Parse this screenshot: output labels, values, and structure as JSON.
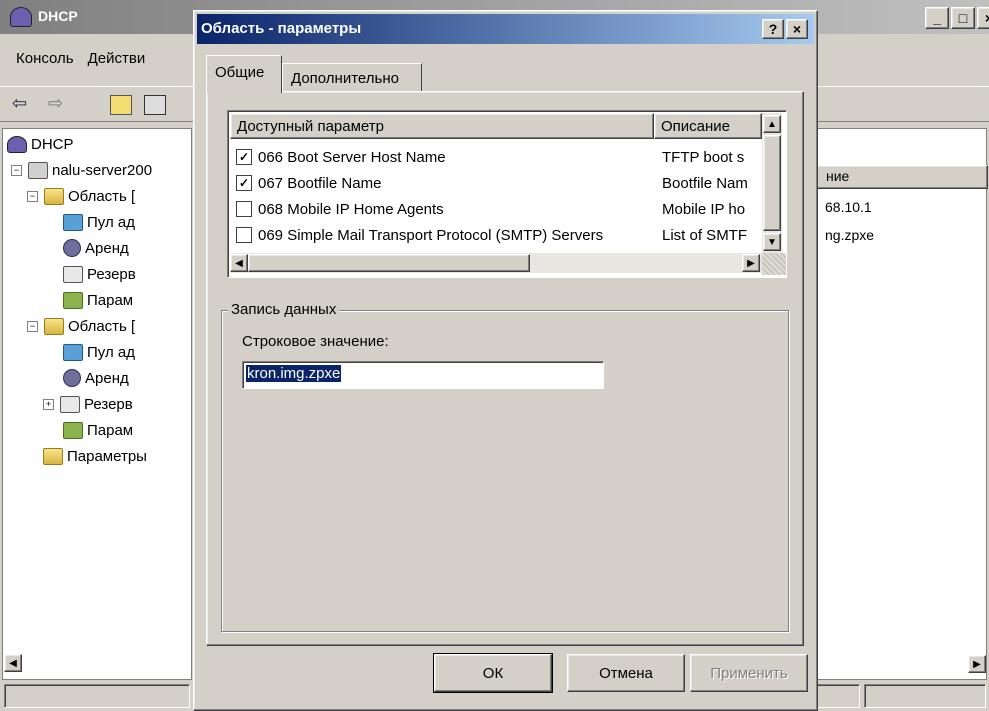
{
  "main_window": {
    "title": "DHCP",
    "menu": [
      "Консоль",
      "Действи"
    ],
    "tree": [
      {
        "label": "DHCP"
      },
      {
        "label": "nalu-server200"
      },
      {
        "label": "Область ["
      },
      {
        "label": "Пул ад"
      },
      {
        "label": "Аренд"
      },
      {
        "label": "Резерв"
      },
      {
        "label": "Парам"
      },
      {
        "label": "Область ["
      },
      {
        "label": "Пул ад"
      },
      {
        "label": "Аренд"
      },
      {
        "label": "Резерв"
      },
      {
        "label": "Парам"
      },
      {
        "label": "Параметры"
      }
    ],
    "right_header": "ние",
    "right_values": [
      "68.10.1",
      "ng.zpxe"
    ]
  },
  "dialog": {
    "title": "Область - параметры",
    "help_label": "?",
    "close_label": "×",
    "tabs": [
      "Общие",
      "Дополнительно"
    ],
    "list_headers": [
      "Доступный параметр",
      "Описание"
    ],
    "options": [
      {
        "name": "066 Boot Server Host Name",
        "desc": "TFTP boot s",
        "checked": true
      },
      {
        "name": "067 Bootfile Name",
        "desc": "Bootfile Nam",
        "checked": true
      },
      {
        "name": "068 Mobile IP Home Agents",
        "desc": "Mobile IP ho",
        "checked": false
      },
      {
        "name": "069 Simple Mail Transport Protocol (SMTP) Servers",
        "desc": "List of SMTF",
        "checked": false
      }
    ],
    "group_label": "Запись данных",
    "field_label": "Строковое значение:",
    "field_value": "kron.img.zpxe",
    "buttons": {
      "ok": "ОК",
      "cancel": "Отмена",
      "apply": "Применить"
    }
  },
  "colors": {
    "titlebar": "#0a246a",
    "selection": "#0a246a",
    "face": "#d4d0c8"
  }
}
